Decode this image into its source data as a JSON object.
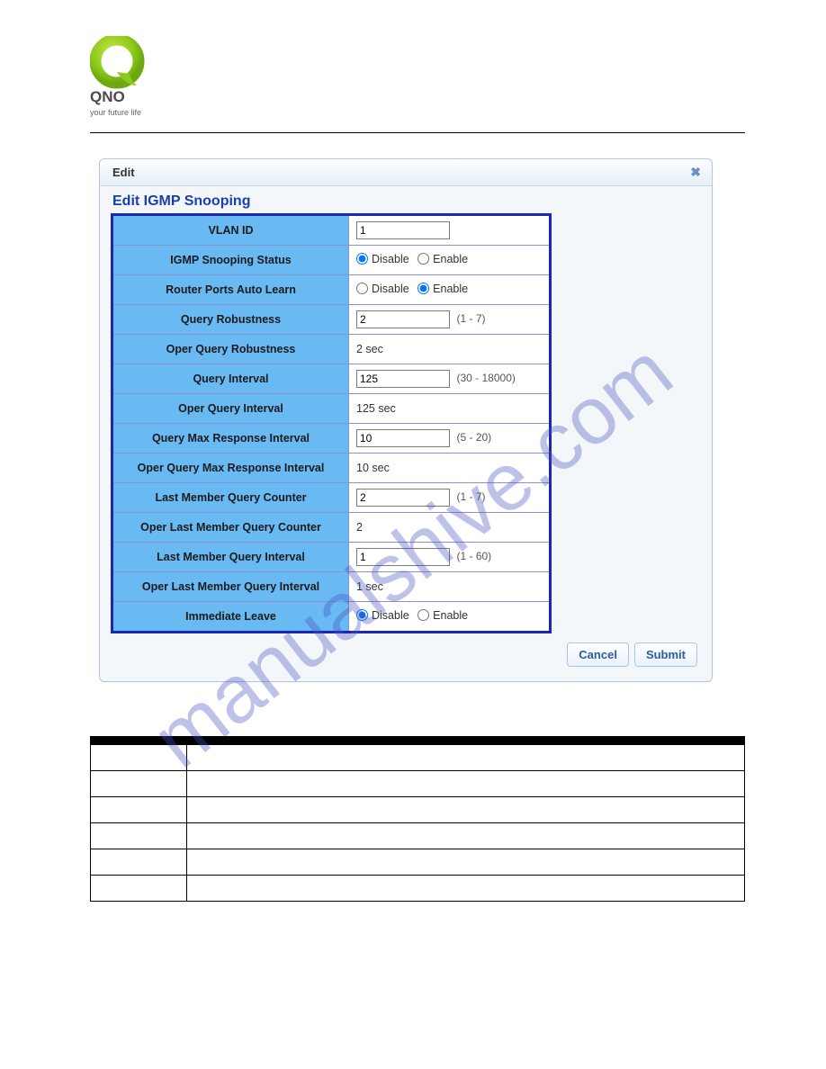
{
  "logo": {
    "brand": "QNO",
    "tagline": "your future life"
  },
  "watermark": "manualshive.com",
  "dialog": {
    "title": "Edit",
    "section_title": "Edit IGMP Snooping",
    "rows": {
      "vlan_id": {
        "label": "VLAN ID",
        "value": "1"
      },
      "snoop_status": {
        "label": "IGMP Snooping Status",
        "disable": "Disable",
        "enable": "Enable",
        "selected": "disable"
      },
      "auto_learn": {
        "label": "Router Ports Auto Learn",
        "disable": "Disable",
        "enable": "Enable",
        "selected": "enable"
      },
      "query_robust": {
        "label": "Query Robustness",
        "value": "2",
        "hint": "(1 - 7)"
      },
      "oper_query_robust": {
        "label": "Oper Query Robustness",
        "text": "2 sec"
      },
      "query_interval": {
        "label": "Query Interval",
        "value": "125",
        "hint": "(30 - 18000)"
      },
      "oper_query_interval": {
        "label": "Oper Query Interval",
        "text": "125 sec"
      },
      "qmri": {
        "label": "Query Max Response Interval",
        "value": "10",
        "hint": "(5 - 20)"
      },
      "oper_qmri": {
        "label": "Oper Query Max Response Interval",
        "text": "10 sec"
      },
      "lmqc": {
        "label": "Last Member Query Counter",
        "value": "2",
        "hint": "(1 - 7)"
      },
      "oper_lmqc": {
        "label": "Oper Last Member Query Counter",
        "text": "2"
      },
      "lmqi": {
        "label": "Last Member Query Interval",
        "value": "1",
        "hint": "(1 - 60)"
      },
      "oper_lmqi": {
        "label": "Oper Last Member Query Interval",
        "text": "1 sec"
      },
      "imm_leave": {
        "label": "Immediate Leave",
        "disable": "Disable",
        "enable": "Enable",
        "selected": "disable"
      }
    },
    "buttons": {
      "cancel": "Cancel",
      "submit": "Submit"
    }
  },
  "def_table": {
    "headers": {
      "term": "",
      "desc": ""
    },
    "rows": [
      {
        "term": "",
        "desc": ""
      },
      {
        "term": "",
        "desc": ""
      },
      {
        "term": "",
        "desc": ""
      },
      {
        "term": "",
        "desc": ""
      },
      {
        "term": "",
        "desc": ""
      },
      {
        "term": "",
        "desc": ""
      }
    ]
  }
}
